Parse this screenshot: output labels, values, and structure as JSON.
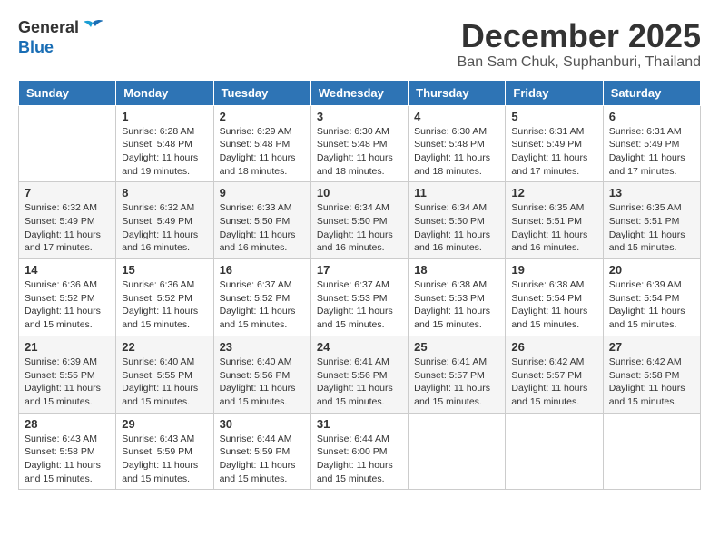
{
  "header": {
    "logo_line1": "General",
    "logo_line2": "Blue",
    "title": "December 2025",
    "subtitle": "Ban Sam Chuk, Suphanburi, Thailand"
  },
  "weekdays": [
    "Sunday",
    "Monday",
    "Tuesday",
    "Wednesday",
    "Thursday",
    "Friday",
    "Saturday"
  ],
  "weeks": [
    [
      {
        "day": "",
        "sunrise": "",
        "sunset": "",
        "daylight": ""
      },
      {
        "day": "1",
        "sunrise": "Sunrise: 6:28 AM",
        "sunset": "Sunset: 5:48 PM",
        "daylight": "Daylight: 11 hours and 19 minutes."
      },
      {
        "day": "2",
        "sunrise": "Sunrise: 6:29 AM",
        "sunset": "Sunset: 5:48 PM",
        "daylight": "Daylight: 11 hours and 18 minutes."
      },
      {
        "day": "3",
        "sunrise": "Sunrise: 6:30 AM",
        "sunset": "Sunset: 5:48 PM",
        "daylight": "Daylight: 11 hours and 18 minutes."
      },
      {
        "day": "4",
        "sunrise": "Sunrise: 6:30 AM",
        "sunset": "Sunset: 5:48 PM",
        "daylight": "Daylight: 11 hours and 18 minutes."
      },
      {
        "day": "5",
        "sunrise": "Sunrise: 6:31 AM",
        "sunset": "Sunset: 5:49 PM",
        "daylight": "Daylight: 11 hours and 17 minutes."
      },
      {
        "day": "6",
        "sunrise": "Sunrise: 6:31 AM",
        "sunset": "Sunset: 5:49 PM",
        "daylight": "Daylight: 11 hours and 17 minutes."
      }
    ],
    [
      {
        "day": "7",
        "sunrise": "Sunrise: 6:32 AM",
        "sunset": "Sunset: 5:49 PM",
        "daylight": "Daylight: 11 hours and 17 minutes."
      },
      {
        "day": "8",
        "sunrise": "Sunrise: 6:32 AM",
        "sunset": "Sunset: 5:49 PM",
        "daylight": "Daylight: 11 hours and 16 minutes."
      },
      {
        "day": "9",
        "sunrise": "Sunrise: 6:33 AM",
        "sunset": "Sunset: 5:50 PM",
        "daylight": "Daylight: 11 hours and 16 minutes."
      },
      {
        "day": "10",
        "sunrise": "Sunrise: 6:34 AM",
        "sunset": "Sunset: 5:50 PM",
        "daylight": "Daylight: 11 hours and 16 minutes."
      },
      {
        "day": "11",
        "sunrise": "Sunrise: 6:34 AM",
        "sunset": "Sunset: 5:50 PM",
        "daylight": "Daylight: 11 hours and 16 minutes."
      },
      {
        "day": "12",
        "sunrise": "Sunrise: 6:35 AM",
        "sunset": "Sunset: 5:51 PM",
        "daylight": "Daylight: 11 hours and 16 minutes."
      },
      {
        "day": "13",
        "sunrise": "Sunrise: 6:35 AM",
        "sunset": "Sunset: 5:51 PM",
        "daylight": "Daylight: 11 hours and 15 minutes."
      }
    ],
    [
      {
        "day": "14",
        "sunrise": "Sunrise: 6:36 AM",
        "sunset": "Sunset: 5:52 PM",
        "daylight": "Daylight: 11 hours and 15 minutes."
      },
      {
        "day": "15",
        "sunrise": "Sunrise: 6:36 AM",
        "sunset": "Sunset: 5:52 PM",
        "daylight": "Daylight: 11 hours and 15 minutes."
      },
      {
        "day": "16",
        "sunrise": "Sunrise: 6:37 AM",
        "sunset": "Sunset: 5:52 PM",
        "daylight": "Daylight: 11 hours and 15 minutes."
      },
      {
        "day": "17",
        "sunrise": "Sunrise: 6:37 AM",
        "sunset": "Sunset: 5:53 PM",
        "daylight": "Daylight: 11 hours and 15 minutes."
      },
      {
        "day": "18",
        "sunrise": "Sunrise: 6:38 AM",
        "sunset": "Sunset: 5:53 PM",
        "daylight": "Daylight: 11 hours and 15 minutes."
      },
      {
        "day": "19",
        "sunrise": "Sunrise: 6:38 AM",
        "sunset": "Sunset: 5:54 PM",
        "daylight": "Daylight: 11 hours and 15 minutes."
      },
      {
        "day": "20",
        "sunrise": "Sunrise: 6:39 AM",
        "sunset": "Sunset: 5:54 PM",
        "daylight": "Daylight: 11 hours and 15 minutes."
      }
    ],
    [
      {
        "day": "21",
        "sunrise": "Sunrise: 6:39 AM",
        "sunset": "Sunset: 5:55 PM",
        "daylight": "Daylight: 11 hours and 15 minutes."
      },
      {
        "day": "22",
        "sunrise": "Sunrise: 6:40 AM",
        "sunset": "Sunset: 5:55 PM",
        "daylight": "Daylight: 11 hours and 15 minutes."
      },
      {
        "day": "23",
        "sunrise": "Sunrise: 6:40 AM",
        "sunset": "Sunset: 5:56 PM",
        "daylight": "Daylight: 11 hours and 15 minutes."
      },
      {
        "day": "24",
        "sunrise": "Sunrise: 6:41 AM",
        "sunset": "Sunset: 5:56 PM",
        "daylight": "Daylight: 11 hours and 15 minutes."
      },
      {
        "day": "25",
        "sunrise": "Sunrise: 6:41 AM",
        "sunset": "Sunset: 5:57 PM",
        "daylight": "Daylight: 11 hours and 15 minutes."
      },
      {
        "day": "26",
        "sunrise": "Sunrise: 6:42 AM",
        "sunset": "Sunset: 5:57 PM",
        "daylight": "Daylight: 11 hours and 15 minutes."
      },
      {
        "day": "27",
        "sunrise": "Sunrise: 6:42 AM",
        "sunset": "Sunset: 5:58 PM",
        "daylight": "Daylight: 11 hours and 15 minutes."
      }
    ],
    [
      {
        "day": "28",
        "sunrise": "Sunrise: 6:43 AM",
        "sunset": "Sunset: 5:58 PM",
        "daylight": "Daylight: 11 hours and 15 minutes."
      },
      {
        "day": "29",
        "sunrise": "Sunrise: 6:43 AM",
        "sunset": "Sunset: 5:59 PM",
        "daylight": "Daylight: 11 hours and 15 minutes."
      },
      {
        "day": "30",
        "sunrise": "Sunrise: 6:44 AM",
        "sunset": "Sunset: 5:59 PM",
        "daylight": "Daylight: 11 hours and 15 minutes."
      },
      {
        "day": "31",
        "sunrise": "Sunrise: 6:44 AM",
        "sunset": "Sunset: 6:00 PM",
        "daylight": "Daylight: 11 hours and 15 minutes."
      },
      {
        "day": "",
        "sunrise": "",
        "sunset": "",
        "daylight": ""
      },
      {
        "day": "",
        "sunrise": "",
        "sunset": "",
        "daylight": ""
      },
      {
        "day": "",
        "sunrise": "",
        "sunset": "",
        "daylight": ""
      }
    ]
  ]
}
